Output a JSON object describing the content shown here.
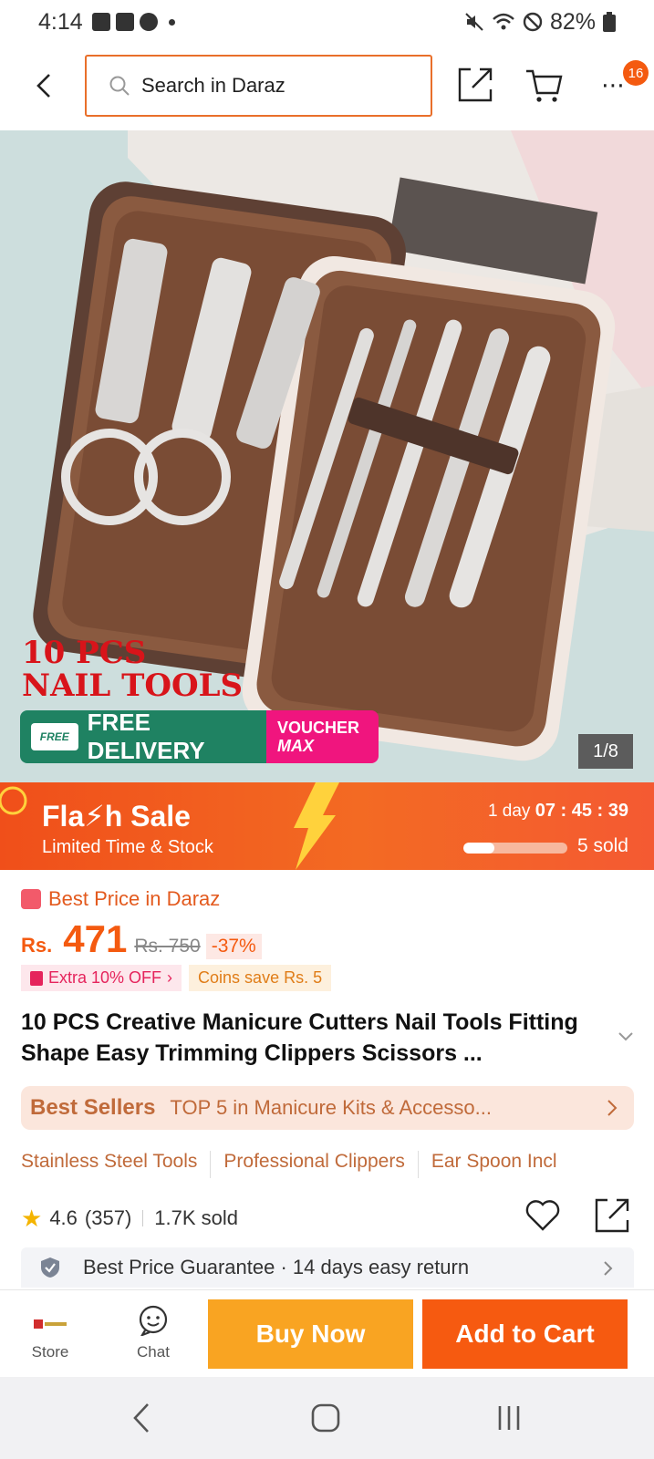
{
  "status": {
    "time": "4:14",
    "battery": "82%"
  },
  "header": {
    "search_placeholder": "Search in Daraz",
    "cart_badge": "16"
  },
  "hero": {
    "caption_line1": "10 PCS",
    "caption_line2": "NAIL TOOLS",
    "delivery_label": "FREE DELIVERY",
    "delivery_truck_text": "FREE",
    "voucher_line1": "VOUCHER",
    "voucher_line2": "MAX",
    "counter": "1/8"
  },
  "flash": {
    "title": "Fla⚡h Sale",
    "subtitle": "Limited Time & Stock",
    "countdown_prefix": "1 day",
    "countdown_time": "07 : 45 : 39",
    "sold": "5 sold",
    "sold_progress": 0.3
  },
  "price": {
    "best_price_label": "Best Price in Daraz",
    "currency": "Rs.",
    "amount": "471",
    "old_price": "Rs. 750",
    "discount": "-37%",
    "extra_off": "Extra 10% OFF",
    "coins": "Coins save Rs. 5"
  },
  "product": {
    "title": "10 PCS Creative Manicure Cutters Nail Tools Fitting Shape Easy Trimming Clippers Scissors ..."
  },
  "bestsellers": {
    "label": "Best Sellers",
    "text": "TOP 5 in Manicure Kits & Accesso..."
  },
  "tags": [
    "Stainless Steel Tools",
    "Professional Clippers",
    "Ear Spoon Incl"
  ],
  "rating": {
    "score": "4.6",
    "count": "(357)",
    "sold": "1.7K sold"
  },
  "guarantee": {
    "text": "Best Price Guarantee · 14 days easy return"
  },
  "actions": {
    "store": "Store",
    "chat": "Chat",
    "buy_now": "Buy Now",
    "add_to_cart": "Add to Cart"
  },
  "colors": {
    "brand": "#f45a10",
    "buy": "#f9a422",
    "flash": "#f04f1a"
  }
}
